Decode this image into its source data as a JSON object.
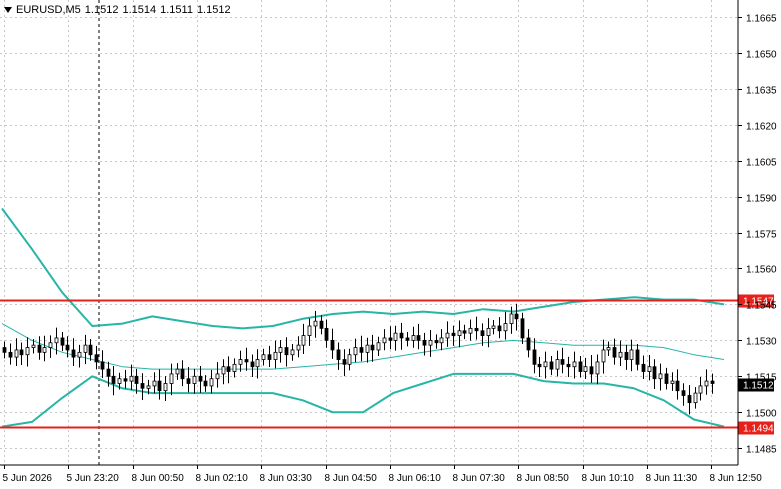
{
  "header": {
    "symbol": "EURUSD,M5",
    "open": "1.1512",
    "high": "1.1514",
    "low": "1.1511",
    "close": "1.1512"
  },
  "colors": {
    "background": "#ffffff",
    "grid": "#c8c8c8",
    "candle": "#000000",
    "bands": "#26b5a6",
    "level_line": "#e8201a",
    "price_tag": "#e8201a",
    "current_tag": "#000000"
  },
  "chart_data": {
    "type": "candlestick",
    "symbol": "EURUSD",
    "timeframe": "M5",
    "ylim": [
      1.1478,
      1.1672
    ],
    "y_ticks": [
      "1.1665",
      "1.1650",
      "1.1635",
      "1.1620",
      "1.1605",
      "1.1590",
      "1.1575",
      "1.1560",
      "1.1545",
      "1.1530",
      "1.1515",
      "1.1500",
      "1.1485"
    ],
    "x_ticks": [
      "5 Jun 2026",
      "5 Jun 23:20",
      "8 Jun 00:50",
      "8 Jun 02:10",
      "8 Jun 03:30",
      "8 Jun 04:50",
      "8 Jun 06:10",
      "8 Jun 07:30",
      "8 Jun 08:50",
      "8 Jun 10:10",
      "8 Jun 11:30",
      "8 Jun 12:50"
    ],
    "levels": [
      {
        "value": 1.1547,
        "label": "1.1547"
      },
      {
        "value": 1.1494,
        "label": "1.1494"
      }
    ],
    "current_price": {
      "value": 1.1512,
      "label": "1.1512"
    },
    "candles_close": [
      1.1525,
      1.1523,
      1.1526,
      1.1524,
      1.1527,
      1.1528,
      1.1525,
      1.1527,
      1.1529,
      1.1531,
      1.1528,
      1.1526,
      1.1523,
      1.1525,
      1.1528,
      1.1524,
      1.1521,
      1.1518,
      1.1515,
      1.1512,
      1.1514,
      1.1513,
      1.1515,
      1.1512,
      1.151,
      1.1511,
      1.1513,
      1.1509,
      1.1512,
      1.1516,
      1.1518,
      1.1514,
      1.1512,
      1.1515,
      1.1513,
      1.1511,
      1.1514,
      1.1516,
      1.1519,
      1.1517,
      1.152,
      1.1522,
      1.1521,
      1.1519,
      1.1522,
      1.1524,
      1.1522,
      1.1525,
      1.1527,
      1.1524,
      1.1526,
      1.1528,
      1.1532,
      1.1536,
      1.1538,
      1.1535,
      1.153,
      1.1526,
      1.1522,
      1.152,
      1.1524,
      1.1527,
      1.1525,
      1.1528,
      1.1526,
      1.1529,
      1.1531,
      1.153,
      1.1533,
      1.1531,
      1.153,
      1.1532,
      1.153,
      1.1528,
      1.153,
      1.1529,
      1.1531,
      1.1533,
      1.1532,
      1.1534,
      1.1533,
      1.1535,
      1.1534,
      1.1532,
      1.1535,
      1.1536,
      1.1534,
      1.1537,
      1.1541,
      1.1539,
      1.1531,
      1.1526,
      1.152,
      1.1519,
      1.1521,
      1.1518,
      1.1522,
      1.152,
      1.1519,
      1.1521,
      1.1517,
      1.1519,
      1.1516,
      1.1521,
      1.1526,
      1.1527,
      1.1523,
      1.1525,
      1.1522,
      1.1526,
      1.152,
      1.1517,
      1.1519,
      1.1514,
      1.1516,
      1.1512,
      1.1513,
      1.1509,
      1.1507,
      1.1504,
      1.1508,
      1.1511,
      1.1513,
      1.1512
    ],
    "upper_band": [
      1.1585,
      1.1568,
      1.155,
      1.1536,
      1.1537,
      1.154,
      1.1538,
      1.1536,
      1.1535,
      1.1536,
      1.1539,
      1.1541,
      1.1542,
      1.1541,
      1.1542,
      1.1541,
      1.1543,
      1.1542,
      1.1544,
      1.1546,
      1.1547,
      1.1548,
      1.1547,
      1.1547,
      1.1545
    ],
    "lower_band": [
      1.1494,
      1.1496,
      1.1506,
      1.1515,
      1.151,
      1.1508,
      1.1508,
      1.1508,
      1.1508,
      1.1508,
      1.1505,
      1.15,
      1.15,
      1.1508,
      1.1512,
      1.1516,
      1.1516,
      1.1516,
      1.1513,
      1.1512,
      1.1512,
      1.151,
      1.1505,
      1.1497,
      1.1494
    ],
    "middle_band": [
      1.1537,
      1.153,
      1.1525,
      1.1522,
      1.1519,
      1.1518,
      1.1518,
      1.1518,
      1.1518,
      1.1518,
      1.1519,
      1.152,
      1.1521,
      1.1523,
      1.1525,
      1.1527,
      1.1529,
      1.153,
      1.1529,
      1.1528,
      1.1528,
      1.1528,
      1.1527,
      1.1524,
      1.1522
    ]
  }
}
